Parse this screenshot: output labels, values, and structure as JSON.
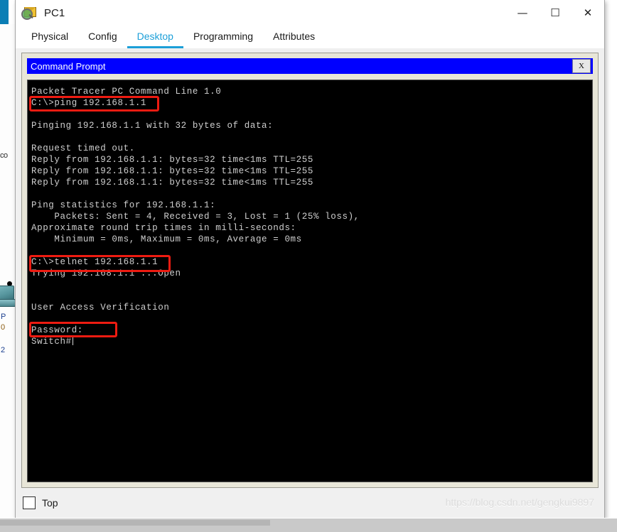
{
  "window": {
    "title": "PC1",
    "icon": "inspect-envelope-icon",
    "controls": {
      "minimize": "—",
      "maximize": "☐",
      "close": "✕"
    }
  },
  "tabs": [
    {
      "label": "Physical",
      "active": false
    },
    {
      "label": "Config",
      "active": false
    },
    {
      "label": "Desktop",
      "active": true
    },
    {
      "label": "Programming",
      "active": false
    },
    {
      "label": "Attributes",
      "active": false
    }
  ],
  "command_prompt": {
    "title": "Command Prompt",
    "close_label": "X",
    "terminal_lines": [
      "Packet Tracer PC Command Line 1.0",
      "C:\\>ping 192.168.1.1",
      "",
      "Pinging 192.168.1.1 with 32 bytes of data:",
      "",
      "Request timed out.",
      "Reply from 192.168.1.1: bytes=32 time<1ms TTL=255",
      "Reply from 192.168.1.1: bytes=32 time<1ms TTL=255",
      "Reply from 192.168.1.1: bytes=32 time<1ms TTL=255",
      "",
      "Ping statistics for 192.168.1.1:",
      "    Packets: Sent = 4, Received = 3, Lost = 1 (25% loss),",
      "Approximate round trip times in milli-seconds:",
      "    Minimum = 0ms, Maximum = 0ms, Average = 0ms",
      "",
      "C:\\>telnet 192.168.1.1",
      "Trying 192.168.1.1 ...Open",
      "",
      "",
      "User Access Verification",
      "",
      "Password:",
      "Switch#"
    ],
    "annotations": [
      {
        "name": "ping-command",
        "text": "C:\\>ping 192.168.1.1"
      },
      {
        "name": "telnet-command",
        "text": "C:\\>telnet 192.168.1.1"
      },
      {
        "name": "password-prompt",
        "text": "Password:"
      }
    ]
  },
  "bottom_bar": {
    "top_checkbox_label": "Top",
    "top_checkbox_checked": false
  },
  "watermark": "https://blog.csdn.net/gengkui9897",
  "background_workspace": {
    "scroll_text": "co",
    "device_labels": [
      "P",
      "0",
      "2"
    ]
  },
  "colors": {
    "tab_accent": "#1c9fd8",
    "cmd_titlebar": "#0000ff",
    "annotation_red": "#ee1b11",
    "panel_beige": "#e8e6d8",
    "terminal_bg": "#000000",
    "terminal_fg": "#cfcfcf"
  }
}
